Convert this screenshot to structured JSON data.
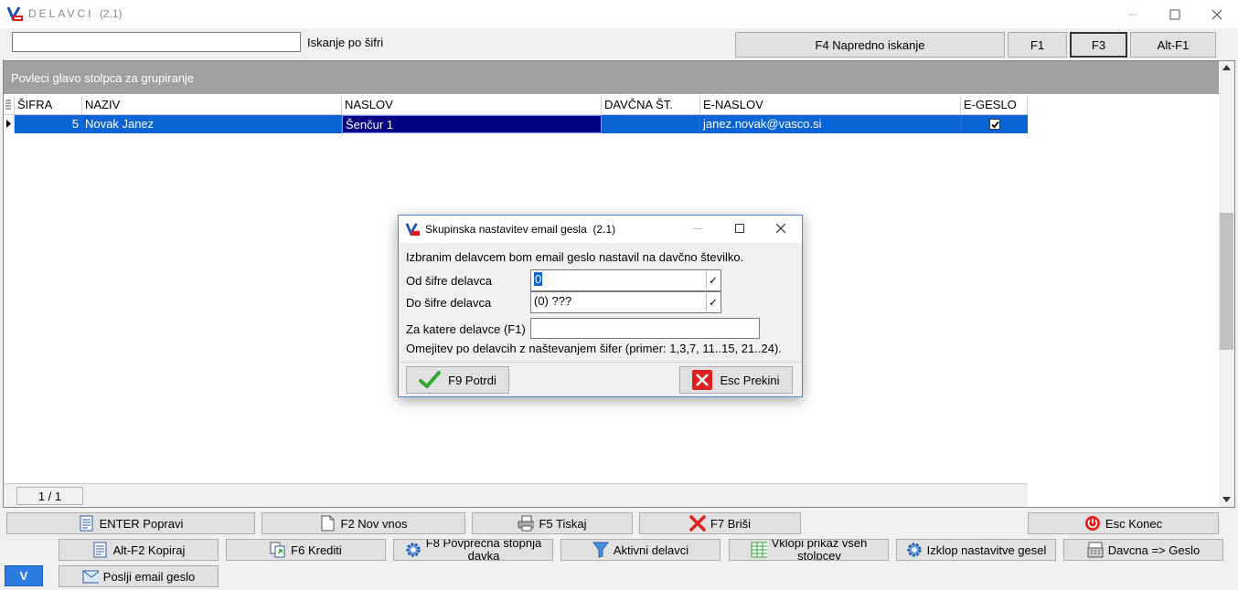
{
  "window": {
    "title": "DELAVCI",
    "version": "(2.1)"
  },
  "search": {
    "value": "",
    "label": "Iskanje po šifri"
  },
  "toolbar": {
    "advanced_search": "F4  Napredno iskanje",
    "f1": "F1",
    "f3": "F3",
    "altf1": "Alt-F1"
  },
  "grid": {
    "group_hint": "Povleci glavo stolpca za grupiranje",
    "columns": [
      "ŠIFRA",
      "NAZIV",
      "NASLOV",
      "DAVČNA ŠT.",
      "E-NASLOV",
      "E-GESLO"
    ],
    "rows": [
      {
        "sifra": "5",
        "naziv": "Novak Janez",
        "naslov": "Šenčur 1",
        "davcna": "",
        "email": "janez.novak@vasco.si",
        "egeslo": true
      }
    ],
    "page_indicator": "1 / 1"
  },
  "buttons_row1": {
    "edit": "ENTER Popravi",
    "new": "F2 Nov vnos",
    "print": "F5 Tiskaj",
    "delete": "F7 Briši",
    "exit": "Esc Konec"
  },
  "buttons_row2": {
    "copy": "Alt-F2 Kopiraj",
    "credits": "F6 Krediti",
    "avg_tax_line1": "F8  Povprečna stopnja",
    "avg_tax_line2": "davka",
    "active": "Aktivni delavci",
    "show_cols_line1": "Vklopi prikaz vseh",
    "show_cols_line2": "stolpcev",
    "disable_pw": "Izklop nastavitve gesel",
    "tax_to_pw": "Davcna => Geslo"
  },
  "buttons_row3": {
    "v_label": "V",
    "send_pw": "Poslji email geslo"
  },
  "dialog": {
    "title": "Skupinska nastavitev email gesla",
    "version": "(2.1)",
    "message": "Izbranim delavcem bom email geslo nastavil na davčno številko.",
    "from_label": "Od šifre delavca",
    "from_value": "0",
    "to_label": "Do šifre delavca",
    "to_value": "(0) ???",
    "which_label": "Za katere delavce (F1)",
    "which_value": "",
    "hint": "Omejitev po delavcih z naštevanjem šifer (primer: 1,3,7, 11..15, 21..24).",
    "confirm": "F9 Potrdi",
    "cancel": "Esc Prekini"
  },
  "colors": {
    "selection": "#0a64d6",
    "selected_cell": "#000080",
    "group_bar": "#a0a0a0",
    "close_red": "#e0201e",
    "check_green": "#2fa82f"
  }
}
